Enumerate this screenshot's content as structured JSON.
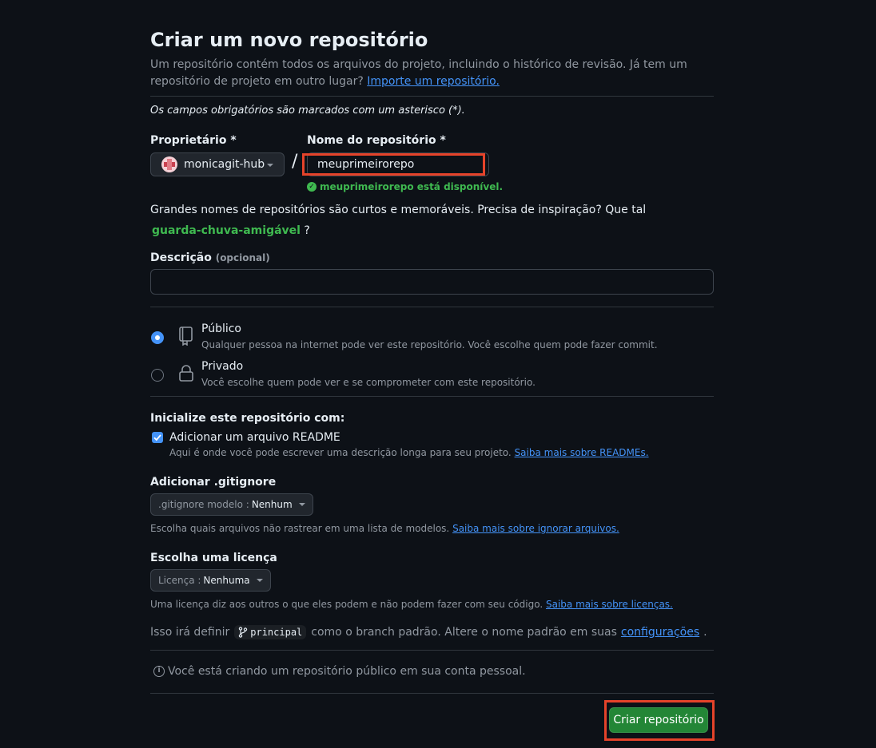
{
  "header": {
    "title": "Criar um novo repositório",
    "subtitle": "Um repositório contém todos os arquivos do projeto, incluindo o histórico de revisão. Já tem um repositório de projeto em outro lugar?",
    "import_link": "Importe um repositório."
  },
  "required_note": "Os campos obrigatórios são marcados com um asterisco (*).",
  "owner": {
    "label": "Proprietário *",
    "value": "monicagit-hub"
  },
  "separator": "/",
  "repo_name": {
    "label": "Nome do repositório *",
    "value": "meuprimeirorepo",
    "availability": "meuprimeirorepo está disponível."
  },
  "inspiration": {
    "text": "Grandes nomes de repositórios são curtos e memoráveis. Precisa de inspiração? Que tal",
    "suggestion": "guarda-chuva-amigável",
    "suffix": "?"
  },
  "description": {
    "label": "Descrição",
    "optional": "(opcional)",
    "value": ""
  },
  "visibility": {
    "public": {
      "title": "Público",
      "desc": "Qualquer pessoa na internet pode ver este repositório. Você escolhe quem pode fazer commit.",
      "selected": true
    },
    "private": {
      "title": "Privado",
      "desc": "Você escolhe quem pode ver e se comprometer com este repositório.",
      "selected": false
    }
  },
  "init": {
    "heading": "Inicialize este repositório com:",
    "readme_label": "Adicionar um arquivo README",
    "readme_checked": true,
    "readme_desc": "Aqui é onde você pode escrever uma descrição longa para seu projeto.",
    "readme_link": "Saiba mais sobre READMEs."
  },
  "gitignore": {
    "heading": "Adicionar .gitignore",
    "prefix": ".gitignore modelo :",
    "value": "Nenhum",
    "note": "Escolha quais arquivos não rastrear em uma lista de modelos.",
    "link": "Saiba mais sobre ignorar arquivos."
  },
  "license": {
    "heading": "Escolha uma licença",
    "prefix": "Licença :",
    "value": "Nenhuma",
    "note": "Uma licença diz aos outros o que eles podem e não podem fazer com seu código.",
    "link": "Saiba mais sobre licenças."
  },
  "branch": {
    "prefix": "Isso irá definir",
    "name": "principal",
    "middle": "como o branch padrão. Altere o nome padrão em suas",
    "link": "configurações",
    "suffix": "."
  },
  "info": {
    "text": "Você está criando um repositório público em sua conta pessoal."
  },
  "submit": {
    "label": "Criar repositório"
  },
  "colors": {
    "background": "#0d1117",
    "accent": "#4493f8",
    "success": "#3fb950",
    "button": "#238636",
    "highlight": "#e5432a"
  }
}
